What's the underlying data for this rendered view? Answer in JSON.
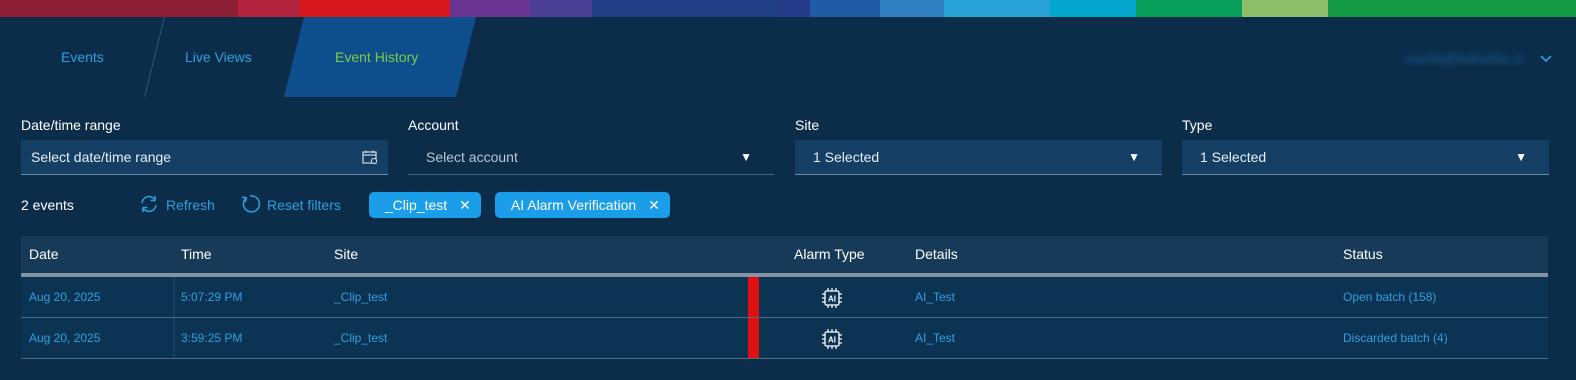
{
  "colors": {
    "background": "#0b2d4a",
    "accent": "#2f9fe0",
    "active_tab_text": "#7ccc44",
    "chip": "#1a9eea",
    "alarm_bar": "#e01010",
    "rainbow": [
      "#8c1f35",
      "#b3233d",
      "#d8161e",
      "#6a3592",
      "#4a3f95",
      "#223e84",
      "#253b8a",
      "#1f5aa4",
      "#2f7fc1",
      "#27a2d6",
      "#05a6cd",
      "#079e5b",
      "#8dbe6a",
      "#149a45"
    ]
  },
  "tabs": [
    {
      "label": "Events"
    },
    {
      "label": "Live Views"
    },
    {
      "label": "Event History",
      "active": true
    }
  ],
  "user_menu": {
    "name": "marilo@kokoriko.cl",
    "icon": "chevron-down-icon"
  },
  "filters": {
    "date": {
      "label": "Date/time range",
      "value": "Select date/time range",
      "icon": "calendar-icon"
    },
    "account": {
      "label": "Account",
      "value": "Select account"
    },
    "site": {
      "label": "Site",
      "value": "1 Selected"
    },
    "type": {
      "label": "Type",
      "value": "1 Selected"
    },
    "arrow": "▼"
  },
  "toolbar": {
    "count": "2 events",
    "refresh": "Refresh",
    "reset": "Reset filters",
    "chips": [
      {
        "label": "_Clip_test"
      },
      {
        "label": "AI Alarm Verification"
      }
    ],
    "chip_close": "✕"
  },
  "table": {
    "headers": {
      "date": "Date",
      "time": "Time",
      "site": "Site",
      "alarm_type": "Alarm Type",
      "details": "Details",
      "status": "Status"
    },
    "rows": [
      {
        "date": "Aug 20, 2025",
        "time": "5:07:29 PM",
        "site": "_Clip_test",
        "alarm_icon": "ai-chip-icon",
        "details": "AI_Test",
        "status": "Open batch (158)"
      },
      {
        "date": "Aug 20, 2025",
        "time": "3:59:25 PM",
        "site": "_Clip_test",
        "alarm_icon": "ai-chip-icon",
        "details": "AI_Test",
        "status": "Discarded batch (4)"
      }
    ]
  }
}
